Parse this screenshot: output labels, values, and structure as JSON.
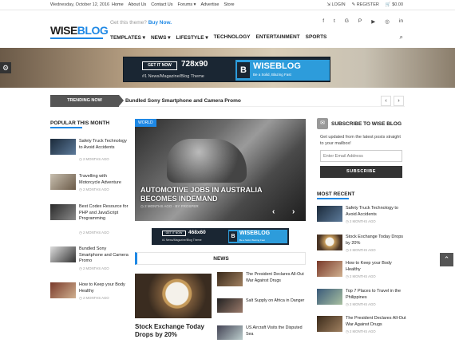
{
  "topbar": {
    "date": "Wednesday, October 12, 2016",
    "links": [
      "Home",
      "About Us",
      "Contact Us",
      "Forums ▾",
      "Advertise",
      "Store"
    ],
    "login": "LOGIN",
    "register": "REGISTER",
    "cart": "$0.00"
  },
  "header": {
    "logo_a": "WISE",
    "logo_b": "BLOG",
    "promo_text": "Get this theme?",
    "promo_link": "Buy Now.",
    "nav": [
      "TEMPLATES ▾",
      "NEWS ▾",
      "LIFESTYLE ▾",
      "TECHNOLOGY",
      "ENTERTAINMENT",
      "SPORTS"
    ]
  },
  "ad728": {
    "cta": "GET IT NOW",
    "size": "728x90",
    "sub": "#1 News/Magazine/Blog Theme",
    "brand": "WISEBLOG",
    "brand_tag": "Be a Solid, Blazing Fast"
  },
  "trending": {
    "label": "TRENDING NOW",
    "text": "Bundled Sony Smartphone and Camera Promo"
  },
  "popular": {
    "title": "POPULAR THIS MONTH",
    "items": [
      {
        "title": "Safety Truck Technology to Avoid Accidents",
        "date": "◷ 2 MONTHS AGO"
      },
      {
        "title": "Travelling with Motorcycle Adventure",
        "date": "◷ 2 MONTHS AGO"
      },
      {
        "title": "Best Codex Resource for PHP and JavaScript Programming",
        "date": "◷ 2 MONTHS AGO"
      },
      {
        "title": "Bundled Sony Smartphone and Camera Promo",
        "date": "◷ 2 MONTHS AGO"
      },
      {
        "title": "How to Keep your Body Healthy",
        "date": "◷ 2 MONTHS AGO"
      }
    ]
  },
  "slider": {
    "category": "WORLD",
    "title": "AUTOMOTIVE JOBS IN AUSTRALIA BECOMES INDEMAND",
    "meta": "◷ 2 MONTHS AGO · BY PROSPER"
  },
  "ad468": {
    "cta": "GET IT NOW",
    "size": "468x60",
    "sub": "#1 News/Magazine/Blog Theme",
    "brand": "WISEBLOG",
    "brand_tag": "Be a Solid, Blazing Fast"
  },
  "news": {
    "title": "NEWS",
    "lead_title": "Stock Exchange Today Drops by 20%",
    "items": [
      {
        "title": "The President Declares All-Out War Against Drugs"
      },
      {
        "title": "Salt Supply on Africa in Danger"
      },
      {
        "title": "US Aircraft Visits the Disputed Sea"
      }
    ]
  },
  "subscribe": {
    "title": "SUBSCRIBE TO WISE BLOG",
    "desc": "Get updated from the latest posts straight to your mailbox!",
    "placeholder": "Enter Email Address",
    "button": "SUBSCRIBE"
  },
  "recent": {
    "title": "MOST RECENT",
    "items": [
      {
        "title": "Safety Truck Technology to Avoid Accidents",
        "date": "◷ 2 MONTHS AGO"
      },
      {
        "title": "Stock Exchange Today Drops by 20%",
        "date": "◷ 2 MONTHS AGO"
      },
      {
        "title": "How to Keep your Body Healthy",
        "date": "◷ 2 MONTHS AGO"
      },
      {
        "title": "Top 7 Places to Travel in the Philippines",
        "date": "◷ 2 MONTHS AGO"
      },
      {
        "title": "The President Declares All-Out War Against Drugs",
        "date": "◷ 2 MONTHS AGO"
      }
    ]
  }
}
